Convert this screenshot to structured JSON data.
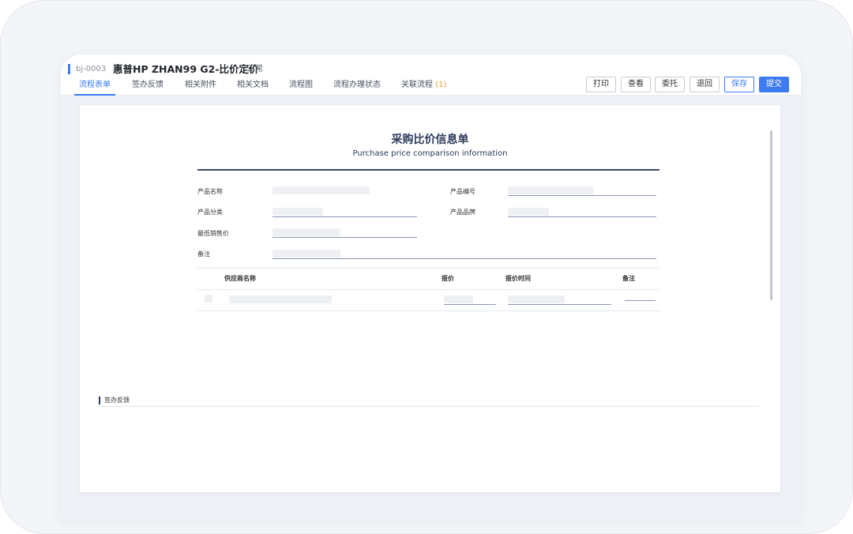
{
  "header": {
    "doc_id": "bj-0003",
    "title": "惠普HP ZHAN99 G2-比价定价",
    "status": "正常"
  },
  "tabs": [
    {
      "label": "流程表单"
    },
    {
      "label": "签办反馈"
    },
    {
      "label": "相关附件"
    },
    {
      "label": "相关文档"
    },
    {
      "label": "流程图"
    },
    {
      "label": "流程办理状态"
    },
    {
      "label": "关联流程",
      "count": "(1)"
    }
  ],
  "toolbar": {
    "print": "打印",
    "view": "查看",
    "delegate": "委托",
    "return": "退回",
    "save": "保存",
    "submit": "提交"
  },
  "form": {
    "title": "采购比价信息单",
    "subtitle": "Purchase price comparison information",
    "fields": {
      "product_name": "产品名称",
      "product_code": "产品编号",
      "product_category": "产品分类",
      "product_brand": "产品品牌",
      "lowest_price": "最低销售价",
      "remarks": "备注"
    },
    "table": {
      "headers": {
        "supplier": "供应商名称",
        "quote": "报价",
        "quote_time": "报价时间",
        "remarks": "备注"
      }
    }
  },
  "feedback_section": {
    "title": "签办反馈"
  },
  "colors": {
    "accent": "#3d7bf0",
    "title_text": "#2b3b5c",
    "tab_count": "#e6a23c"
  }
}
